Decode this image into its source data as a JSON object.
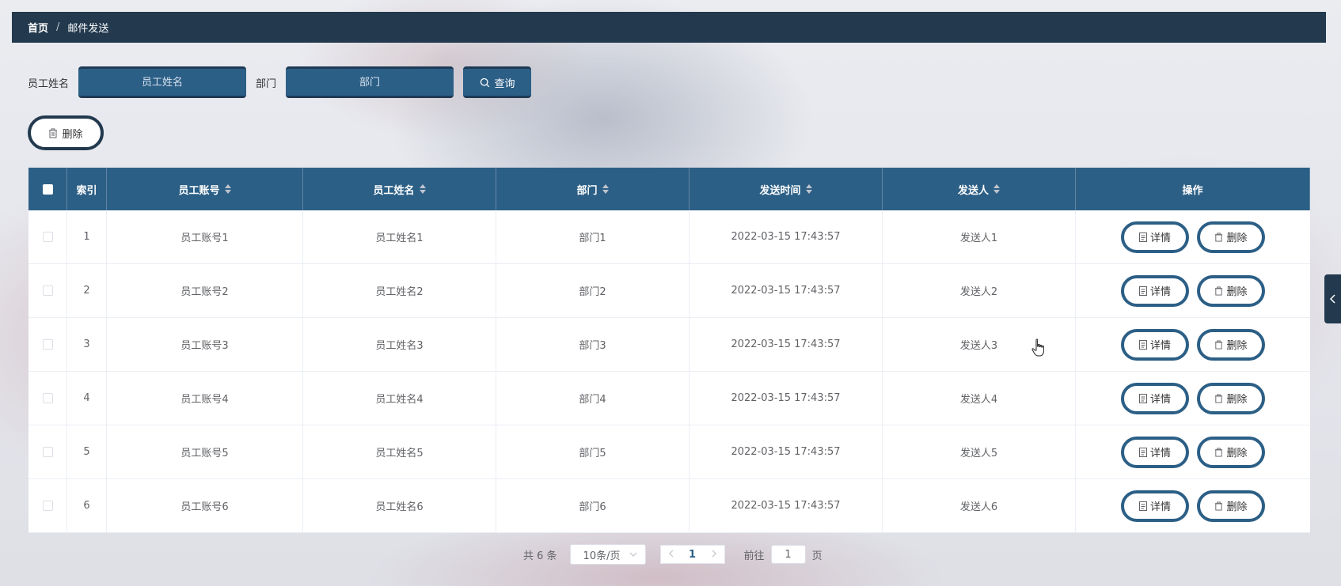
{
  "breadcrumb": {
    "home": "首页",
    "separator": "/",
    "current": "邮件发送"
  },
  "search": {
    "name_label": "员工姓名",
    "name_placeholder": "员工姓名",
    "dept_label": "部门",
    "dept_placeholder": "部门",
    "query_label": "查询"
  },
  "toolbar": {
    "delete_label": "删除"
  },
  "table": {
    "headers": {
      "index": "索引",
      "account": "员工账号",
      "name": "员工姓名",
      "dept": "部门",
      "send_time": "发送时间",
      "sender": "发送人",
      "ops": "操作"
    },
    "detail_label": "详情",
    "delete_label": "删除",
    "rows": [
      {
        "index": "1",
        "account": "员工账号1",
        "name": "员工姓名1",
        "dept": "部门1",
        "send_time": "2022-03-15 17:43:57",
        "sender": "发送人1"
      },
      {
        "index": "2",
        "account": "员工账号2",
        "name": "员工姓名2",
        "dept": "部门2",
        "send_time": "2022-03-15 17:43:57",
        "sender": "发送人2"
      },
      {
        "index": "3",
        "account": "员工账号3",
        "name": "员工姓名3",
        "dept": "部门3",
        "send_time": "2022-03-15 17:43:57",
        "sender": "发送人3"
      },
      {
        "index": "4",
        "account": "员工账号4",
        "name": "员工姓名4",
        "dept": "部门4",
        "send_time": "2022-03-15 17:43:57",
        "sender": "发送人4"
      },
      {
        "index": "5",
        "account": "员工账号5",
        "name": "员工姓名5",
        "dept": "部门5",
        "send_time": "2022-03-15 17:43:57",
        "sender": "发送人5"
      },
      {
        "index": "6",
        "account": "员工账号6",
        "name": "员工姓名6",
        "dept": "部门6",
        "send_time": "2022-03-15 17:43:57",
        "sender": "发送人6"
      }
    ]
  },
  "pagination": {
    "total": "共 6 条",
    "page_size": "10条/页",
    "current_page": "1",
    "goto_label": "前往",
    "goto_value": "1",
    "page_unit": "页"
  },
  "colors": {
    "header_bar": "#22394e",
    "accent": "#2c5f86"
  },
  "icons": {
    "search": "search-icon",
    "delete": "trash-icon",
    "detail": "document-icon",
    "sort": "sort-caret-icon",
    "side_toggle": "chevron-left-icon"
  }
}
